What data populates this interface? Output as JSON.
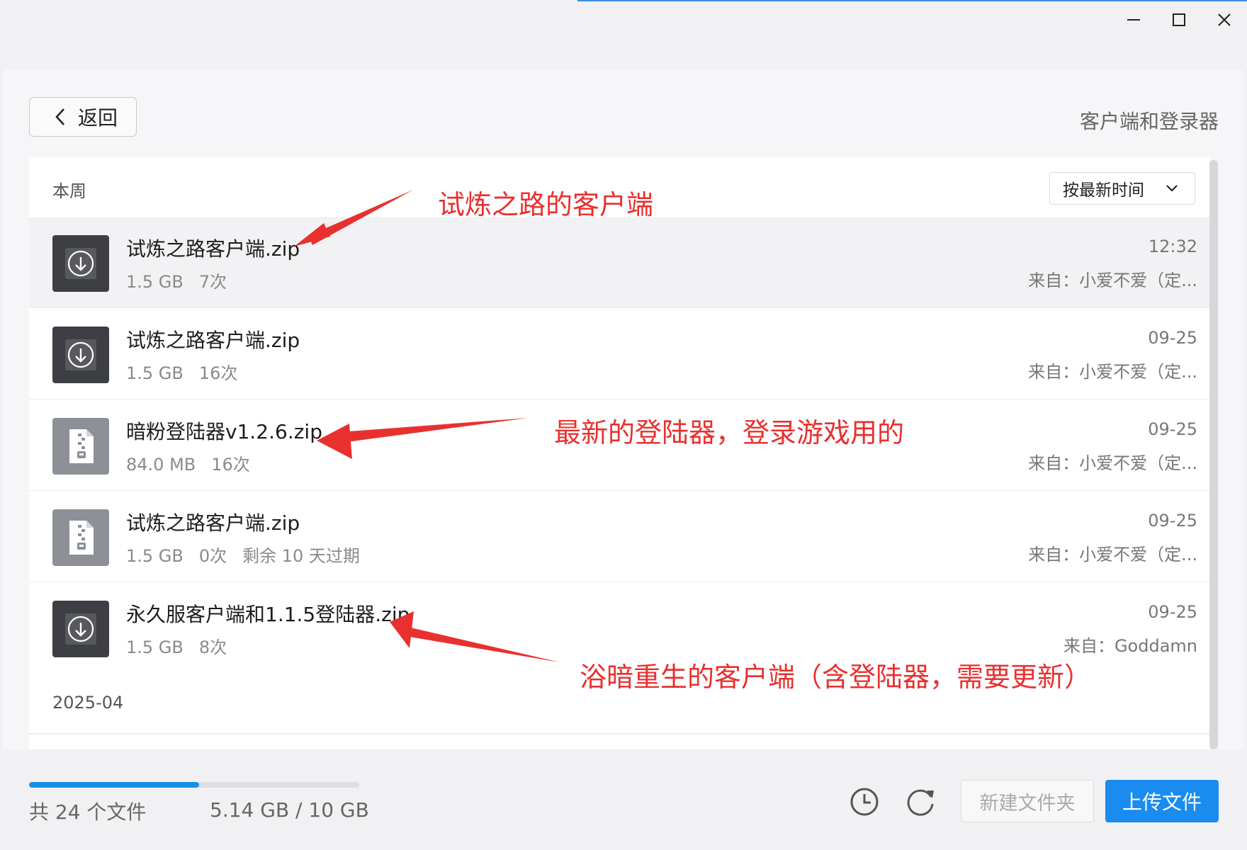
{
  "window": {
    "accent_color": "#3c8ddf",
    "controls": [
      "minimize-icon",
      "maximize-icon",
      "close-icon"
    ]
  },
  "header": {
    "back_label": "返回",
    "page_title": "客户端和登录器"
  },
  "list": {
    "section_week": "本周",
    "section_month": "2025-04",
    "sort_label": "按最新时间",
    "files": [
      {
        "name": "试炼之路客户端.zip",
        "size": "1.5 GB",
        "count": "7次",
        "extra": "",
        "date": "12:32",
        "source": "来自：小爱不爱（定...",
        "icon": "download-archive-icon",
        "icon_style": "dark",
        "selected": true
      },
      {
        "name": "试炼之路客户端.zip",
        "size": "1.5 GB",
        "count": "16次",
        "extra": "",
        "date": "09-25",
        "source": "来自：小爱不爱（定...",
        "icon": "download-archive-icon",
        "icon_style": "dark",
        "selected": false
      },
      {
        "name": "暗粉登陆器v1.2.6.zip",
        "size": "84.0 MB",
        "count": "16次",
        "extra": "",
        "date": "09-25",
        "source": "来自：小爱不爱（定...",
        "icon": "zip-file-icon",
        "icon_style": "light",
        "selected": false
      },
      {
        "name": "试炼之路客户端.zip",
        "size": "1.5 GB",
        "count": "0次",
        "extra": "剩余 10 天过期",
        "date": "09-25",
        "source": "来自：小爱不爱（定...",
        "icon": "zip-file-icon",
        "icon_style": "light",
        "selected": false
      },
      {
        "name": "永久服客户端和1.1.5登陆器.zip",
        "size": "1.5 GB",
        "count": "8次",
        "extra": "",
        "date": "09-25",
        "source": "来自：Goddamn",
        "icon": "download-archive-icon",
        "icon_style": "dark",
        "selected": false
      }
    ]
  },
  "annotations": {
    "a1": "试炼之路的客户端",
    "a2": "最新的登陆器，登录游戏用的",
    "a3": "浴暗重生的客户端（含登陆器，需要更新）",
    "color": "#e8312f"
  },
  "footer": {
    "file_count": "共 24 个文件",
    "storage": "5.14 GB / 10 GB",
    "storage_used_fraction": 0.514,
    "progress_color": "#1a8fe8",
    "new_folder_label": "新建文件夹",
    "upload_label": "上传文件",
    "upload_color": "#1a8cf0"
  }
}
